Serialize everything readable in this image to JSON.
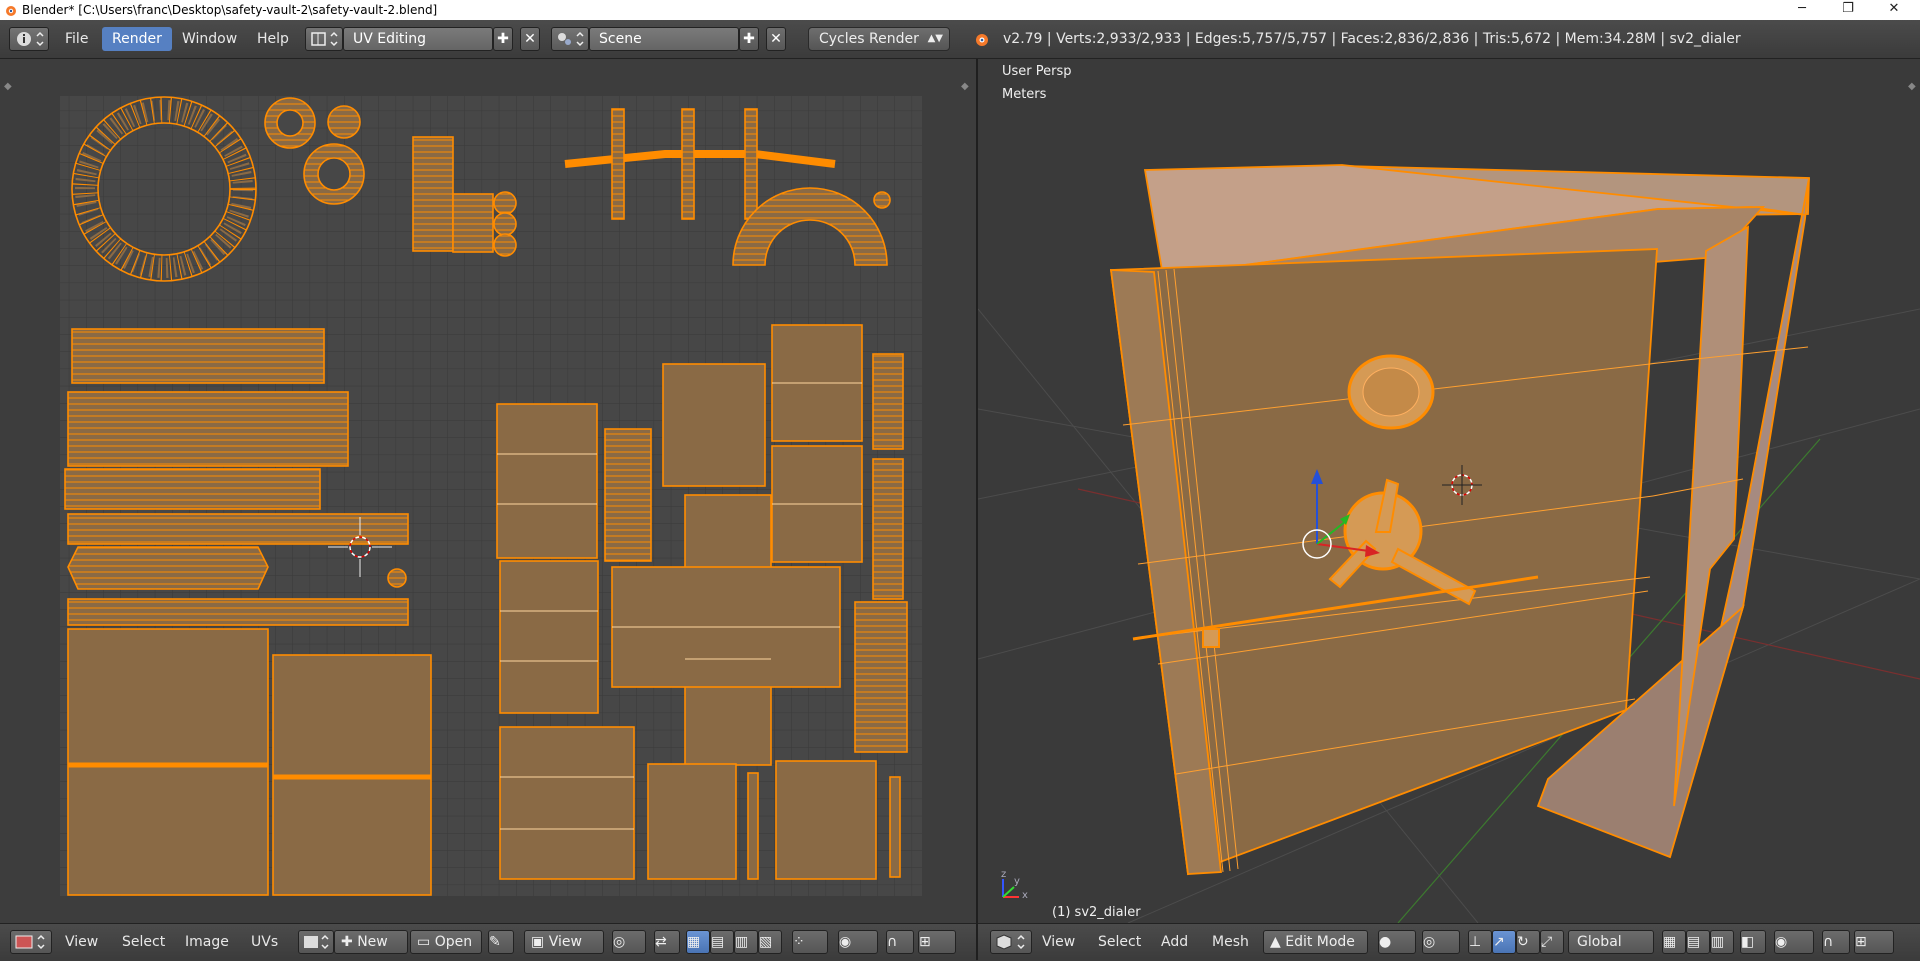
{
  "window": {
    "title": "Blender* [C:\\Users\\franc\\Desktop\\safety-vault-2\\safety-vault-2.blend]",
    "minimize": "─",
    "restore": "❐",
    "close": "✕"
  },
  "top_menu": {
    "file": "File",
    "render": "Render",
    "window": "Window",
    "help": "Help",
    "screen_layout": "UV Editing",
    "scene": "Scene",
    "engine": "Cycles Render",
    "stats": "v2.79 | Verts:2,933/2,933 | Edges:5,757/5,757 | Faces:2,836/2,836 | Tris:5,672 | Mem:34.28M | sv2_dialer"
  },
  "viewport": {
    "view_name": "User Persp",
    "units": "Meters",
    "object_label": "(1) sv2_dialer",
    "axis_x": "x",
    "axis_y": "y",
    "axis_z": "z"
  },
  "uv_footer": {
    "view": "View",
    "select": "Select",
    "image": "Image",
    "uvs": "UVs",
    "new": "New",
    "open": "Open",
    "view2": "View"
  },
  "vp_footer": {
    "view": "View",
    "select": "Select",
    "add": "Add",
    "mesh": "Mesh",
    "mode": "Edit Mode",
    "orientation": "Global"
  },
  "colors": {
    "accent": "#5680c2",
    "wire": "#ff8c00",
    "face": "#8a6a45",
    "grid_bg": "#444444"
  }
}
